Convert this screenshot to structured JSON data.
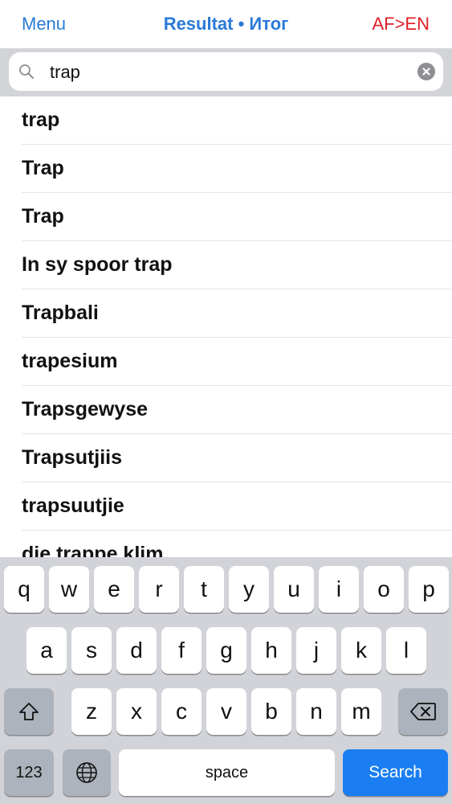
{
  "nav": {
    "menu_label": "Menu",
    "title": "Resultat • Итог",
    "direction_label": "AF>EN"
  },
  "search": {
    "query": "trap"
  },
  "results": [
    "trap",
    "Trap",
    "Trap",
    "In sy spoor trap",
    "Trapbali",
    "trapesium",
    "Trapsgewyse",
    "Trapsutjiis",
    "trapsuutjie",
    "die trappe klim"
  ],
  "keyboard": {
    "row1": [
      "q",
      "w",
      "e",
      "r",
      "t",
      "y",
      "u",
      "i",
      "o",
      "p"
    ],
    "row2": [
      "a",
      "s",
      "d",
      "f",
      "g",
      "h",
      "j",
      "k",
      "l"
    ],
    "row3": [
      "z",
      "x",
      "c",
      "v",
      "b",
      "n",
      "m"
    ],
    "numbers_label": "123",
    "space_label": "space",
    "search_label": "Search"
  },
  "colors": {
    "accent_blue": "#2a7ad6",
    "direction_red": "#e0202a",
    "search_key_blue": "#1a7ef2"
  }
}
